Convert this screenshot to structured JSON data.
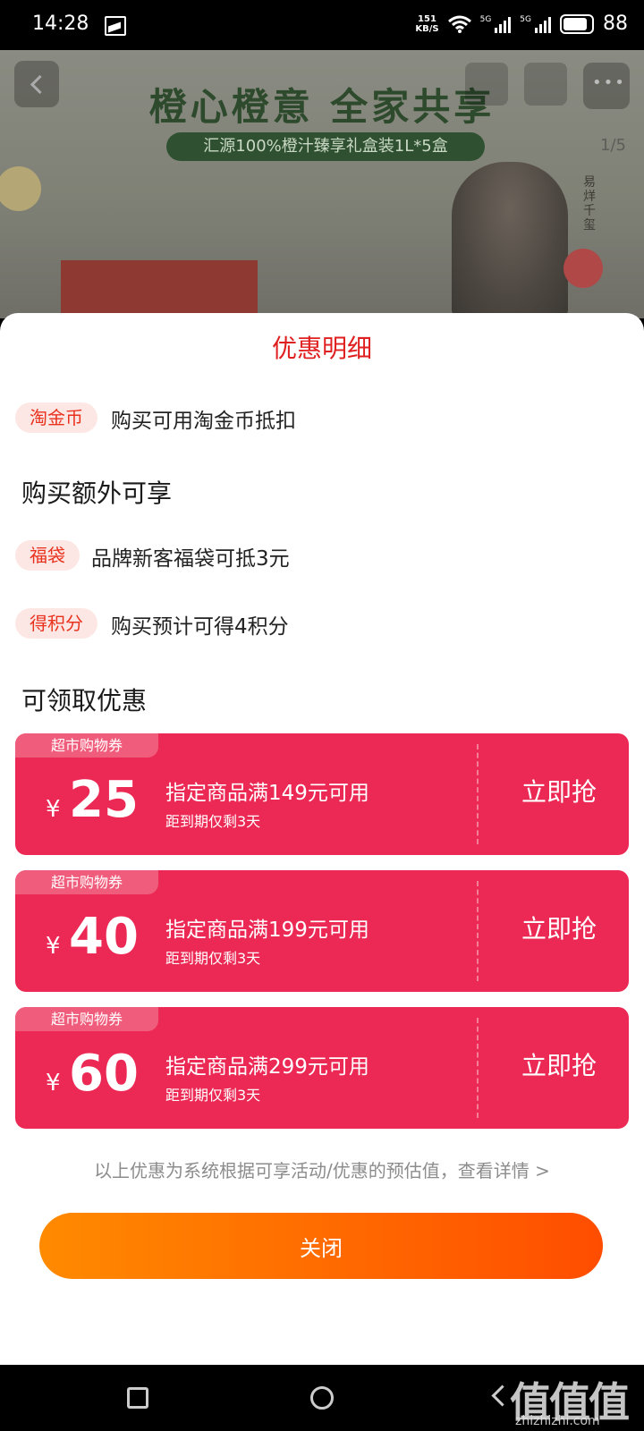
{
  "status_bar": {
    "time": "14:28",
    "speed_value": "151",
    "speed_unit": "KB/S",
    "net1": "5G",
    "net2": "5G",
    "battery": "88"
  },
  "banner": {
    "headline": "橙心橙意 全家共享",
    "product": "汇源100%橙汁臻享礼盒装1L*5盒",
    "pager": "1/5",
    "endorser": "易烊千玺"
  },
  "sheet": {
    "title": "优惠明细",
    "coin_tag": "淘金币",
    "coin_text": "购买可用淘金币抵扣",
    "extra_title": "购买额外可享",
    "extras": [
      {
        "tag": "福袋",
        "text": "品牌新客福袋可抵3元"
      },
      {
        "tag": "得积分",
        "text": "购买预计可得4积分"
      }
    ],
    "claim_title": "可领取优惠",
    "coupons": [
      {
        "tag": "超市购物券",
        "currency": "¥",
        "amount": "25",
        "condition": "指定商品满149元可用",
        "expiry": "距到期仅剩3天",
        "action": "立即抢"
      },
      {
        "tag": "超市购物券",
        "currency": "¥",
        "amount": "40",
        "condition": "指定商品满199元可用",
        "expiry": "距到期仅剩3天",
        "action": "立即抢"
      },
      {
        "tag": "超市购物券",
        "currency": "¥",
        "amount": "60",
        "condition": "指定商品满299元可用",
        "expiry": "距到期仅剩3天",
        "action": "立即抢"
      }
    ],
    "disclaimer": "以上优惠为系统根据可享活动/优惠的预估值，查看详情 >",
    "close_label": "关闭"
  },
  "watermark": {
    "logo": "值值值",
    "url": "zhizhizhi.com"
  },
  "colors": {
    "accent_red": "#e02020",
    "coupon_bg": "#ec2854",
    "button_start": "#ff8a00",
    "button_end": "#ff4d00"
  },
  "icons": [
    "back-icon",
    "share-icon",
    "cart-icon",
    "more-icon",
    "wifi-icon",
    "signal-icon",
    "battery-icon",
    "nav-recents-icon",
    "nav-home-icon",
    "nav-back-icon"
  ]
}
